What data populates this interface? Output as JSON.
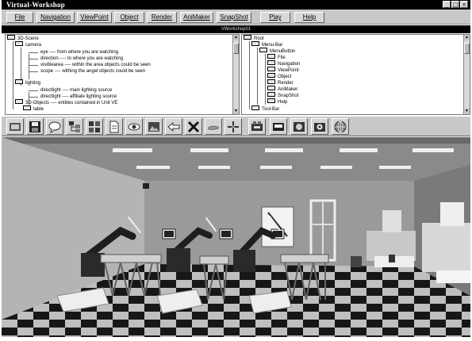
{
  "window": {
    "title": "Virtual-Workshop",
    "buttons": [
      "_",
      "□",
      "×"
    ]
  },
  "menu": {
    "items": [
      {
        "label": "File"
      },
      {
        "label": "Navigation"
      },
      {
        "label": "ViewPoint"
      },
      {
        "label": "Object"
      },
      {
        "label": "Render"
      },
      {
        "label": "AniMaker"
      },
      {
        "label": "SnapShot"
      },
      {
        "label": "Play"
      },
      {
        "label": "Help"
      }
    ]
  },
  "panel_header": "VWorkshop01",
  "left_tree": {
    "rows": [
      {
        "text": "3D-Scene"
      },
      {
        "text": "camera"
      },
      {
        "text": "eye ---- from where you are watching"
      },
      {
        "text": "direction ---- to where you are watching"
      },
      {
        "text": "visiblearea ---- within the area objects could be seen"
      },
      {
        "text": "scope ---- withing the angel objects could be seen"
      },
      {
        "text": "lighting"
      },
      {
        "text": "directlight ---- main lighting source"
      },
      {
        "text": "directlight ---- affiliate lighting source"
      },
      {
        "text": "3D-Objects ---- entities contained in Unit VE"
      },
      {
        "text": "table"
      }
    ]
  },
  "right_tree": {
    "rows": [
      {
        "text": "Root"
      },
      {
        "text": "Menu-Bar"
      },
      {
        "text": "MenuButton"
      },
      {
        "text": "File"
      },
      {
        "text": "Navigation"
      },
      {
        "text": "ViewPoint"
      },
      {
        "text": "Object"
      },
      {
        "text": "Render"
      },
      {
        "text": "AniMaker"
      },
      {
        "text": "SnapShot"
      },
      {
        "text": "Help"
      },
      {
        "text": "Tool-Bar"
      }
    ]
  },
  "toolbar": {
    "tools": [
      {
        "icon": "scene-icon"
      },
      {
        "icon": "save-icon"
      },
      {
        "icon": "speech-bubble-icon"
      },
      {
        "icon": "tree-view-icon"
      },
      {
        "icon": "tile-view-icon"
      },
      {
        "icon": "document-icon"
      },
      {
        "icon": "eye-icon"
      },
      {
        "icon": "image-icon"
      },
      {
        "icon": "back-arrow-icon"
      },
      {
        "icon": "delete-x-icon"
      },
      {
        "icon": "hand-icon"
      },
      {
        "icon": "pointer-icon"
      },
      {
        "icon": "machine-icon"
      },
      {
        "icon": "view-icon"
      },
      {
        "icon": "zoom-icon"
      },
      {
        "icon": "camera-icon"
      },
      {
        "icon": "globe-icon"
      }
    ]
  }
}
